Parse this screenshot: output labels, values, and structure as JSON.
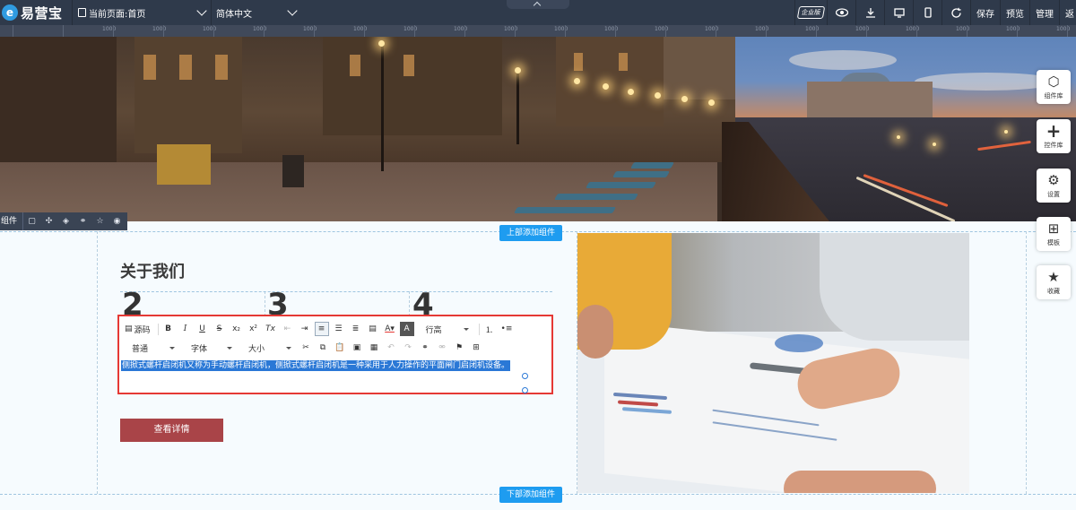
{
  "topbar": {
    "logo_text": "易营宝",
    "logo_mark": "e",
    "page_select": "当前页面:首页",
    "language_select": "简体中文",
    "enterprise_badge": "企业版",
    "icons": [
      "eye-icon",
      "download-icon",
      "desktop-icon",
      "mobile-icon",
      "refresh-icon"
    ],
    "save_label": "保存",
    "preview_label": "预览",
    "manage_label": "管理",
    "back_label": "返"
  },
  "ruler_labels": [
    "1000",
    "1000",
    "1000",
    "1000",
    "1000",
    "1000",
    "1000",
    "1000",
    "1000",
    "1000",
    "1000",
    "1000",
    "1000",
    "1000",
    "1000",
    "1000",
    "1000",
    "1000",
    "1000",
    "1000",
    "1000",
    "1000"
  ],
  "component_toolbar": {
    "label": "组件",
    "icons": [
      "copy-icon",
      "move-icon",
      "layers-icon",
      "link-icon",
      "star-icon",
      "eye-icon"
    ]
  },
  "canvas": {
    "add_top_label": "上部添加组件",
    "add_bottom_label": "下部添加组件",
    "about_title": "关于我们",
    "numbers": [
      "2",
      "3",
      "4"
    ],
    "detail_button": "查看详情"
  },
  "editor": {
    "source_label": "源码",
    "bold": "B",
    "italic": "I",
    "underline": "U",
    "strike": "S",
    "subscript": "x₂",
    "superscript": "x²",
    "clear_format": "Tx",
    "line_height_label": "行高",
    "format_select": "普通",
    "font_select": "字体",
    "size_select": "大小",
    "selected_text": "侧掀式螺杆启闭机又称为手动螺杆启闭机，侧掀式螺杆启闭机是一种采用于人力操作的平面闸门启闭机设备。"
  },
  "side_panel": {
    "component_lib": "组件库",
    "control_lib": "控件库",
    "settings": "设置",
    "template": "模板",
    "favorites": "收藏"
  },
  "colors": {
    "topbar": "#2f3a4b",
    "accent_blue": "#1e9cf0",
    "highlight_red": "#e53935",
    "detail_button": "#a94448",
    "selection": "#2a78d6"
  }
}
